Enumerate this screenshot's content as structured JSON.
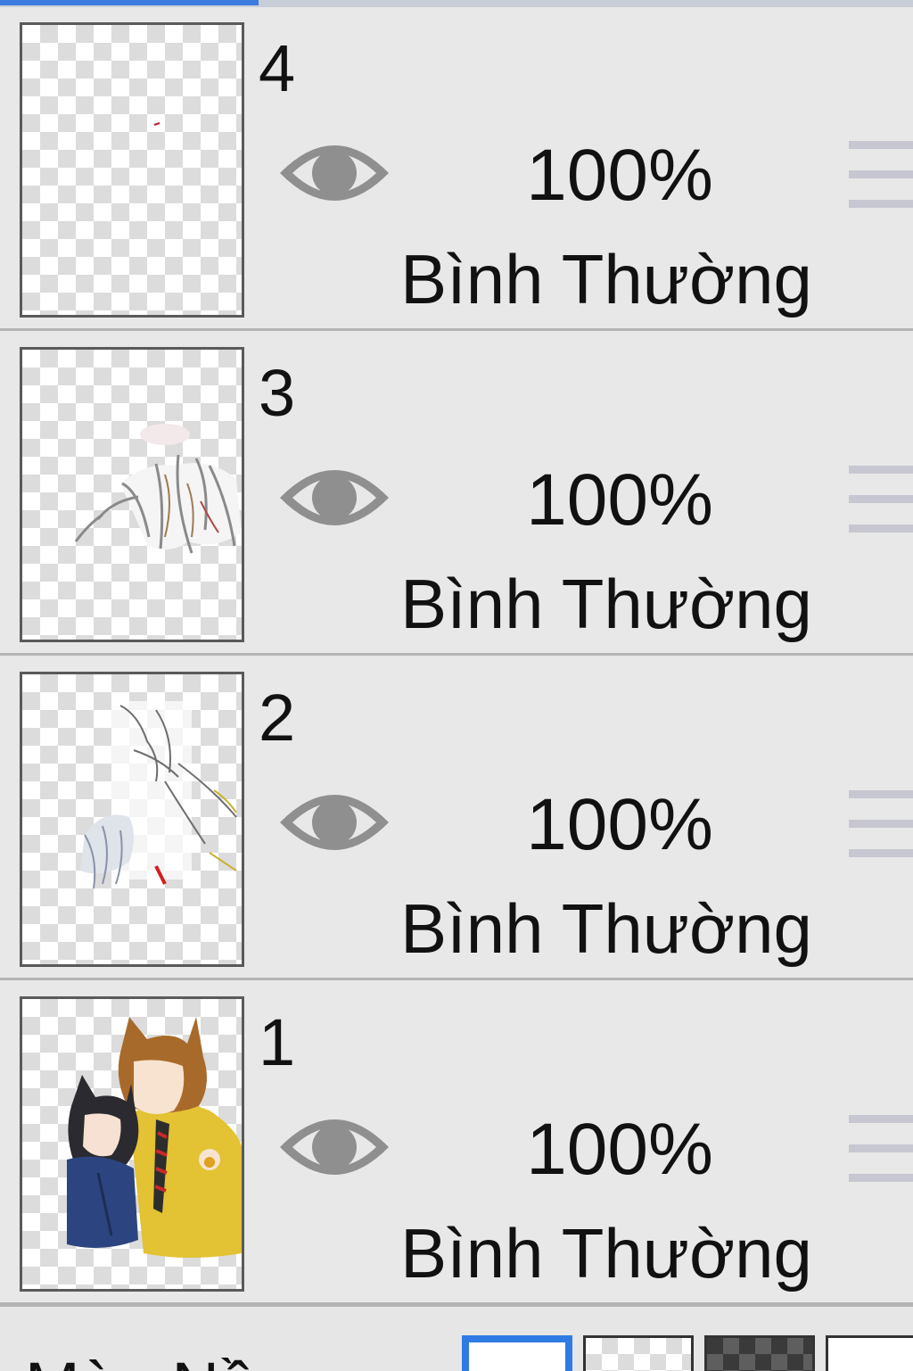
{
  "layers": [
    {
      "number": "4",
      "opacity": "100%",
      "blend_mode": "Bình Thường",
      "visible": true,
      "thumbnail": "mostly-empty"
    },
    {
      "number": "3",
      "opacity": "100%",
      "blend_mode": "Bình Thường",
      "visible": true,
      "thumbnail": "grey-sketch-strokes"
    },
    {
      "number": "2",
      "opacity": "100%",
      "blend_mode": "Bình Thường",
      "visible": true,
      "thumbnail": "line-art-fragments"
    },
    {
      "number": "1",
      "opacity": "100%",
      "blend_mode": "Bình Thường",
      "visible": true,
      "thumbnail": "two-characters-with-cat-ears"
    }
  ],
  "footer": {
    "background_label": "Màu Nền",
    "swatches": [
      "white",
      "light-checker",
      "dark-checker",
      "none"
    ],
    "selected_swatch": "white"
  },
  "colors": {
    "accent": "#3b7be0",
    "panel_bg": "#e8e8e8",
    "eye_icon": "#8f8f8f",
    "drag_handle": "#c7c7d2"
  },
  "icons": {
    "visibility": "eye-icon",
    "reorder": "drag-handle-icon"
  }
}
